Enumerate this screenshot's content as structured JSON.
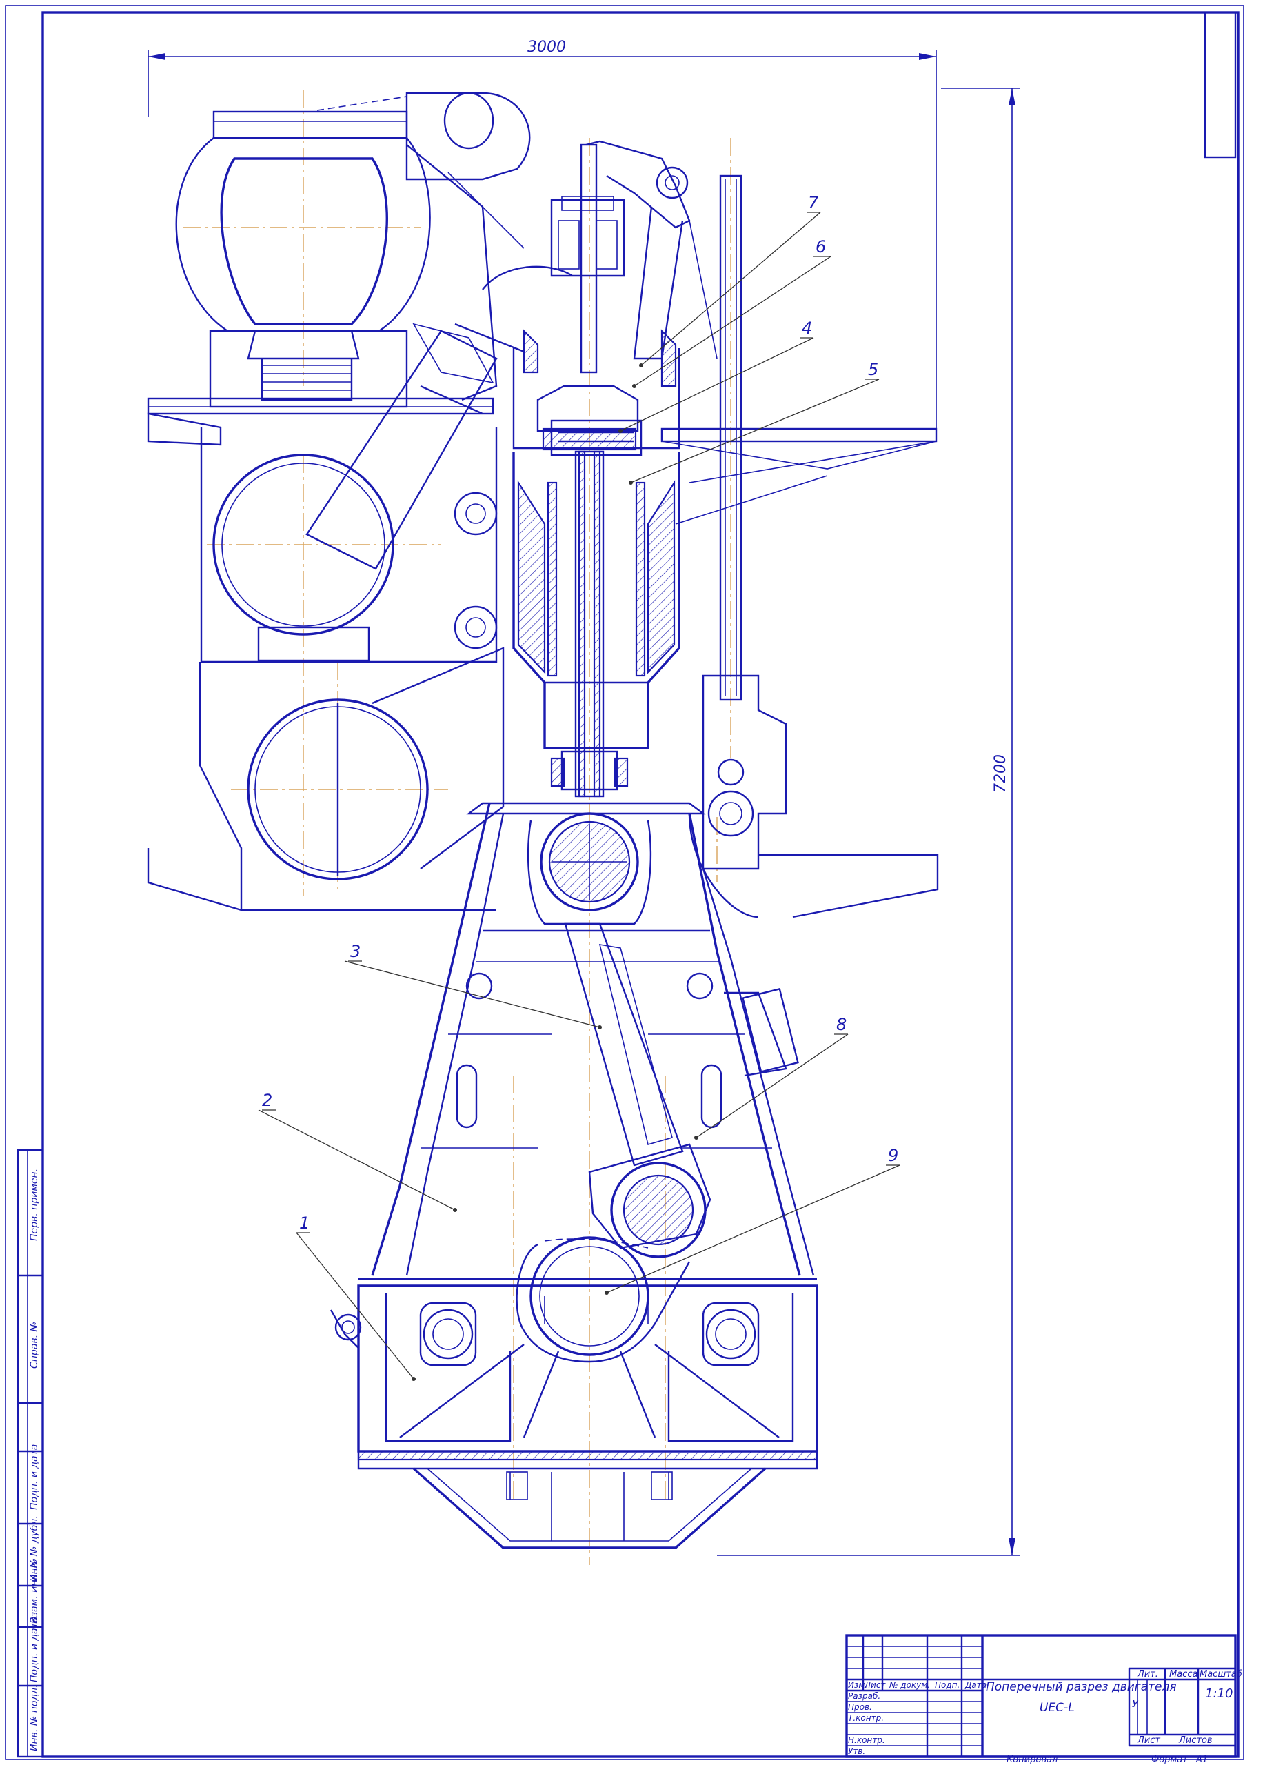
{
  "drawing": {
    "dimensions": {
      "width": "3000",
      "height": "7200"
    },
    "callouts": [
      "1",
      "2",
      "3",
      "4",
      "5",
      "6",
      "7",
      "8",
      "9"
    ]
  },
  "side_stamp": [
    "Перв. примен.",
    "Справ. №",
    "Подп. и дата",
    "Инв. № дубл.",
    "Взам. инв. №",
    "Подп. и дата",
    "Инв. № подл."
  ],
  "title_block": {
    "title_line1": "Поперечный разрез двигателя",
    "title_line2": "UEC-L",
    "col_headers": [
      "Изм.",
      "Лист",
      "№ докум.",
      "Подп.",
      "Дата"
    ],
    "roles": [
      "Разраб.",
      "Пров.",
      "Т.контр.",
      "Н.контр.",
      "Утв."
    ],
    "lit_label": "Лит.",
    "mass_label": "Масса",
    "scale_label": "Масштаб",
    "lit_value": "У",
    "scale_value": "1:10",
    "sheet_label": "Лист",
    "sheets_label": "Листов",
    "copied_label": "Копировал",
    "format_label": "Формат",
    "format_value": "A1"
  },
  "colors": {
    "line": "#1a1ab0",
    "axis": "#d9a35a",
    "leader": "#333333"
  }
}
